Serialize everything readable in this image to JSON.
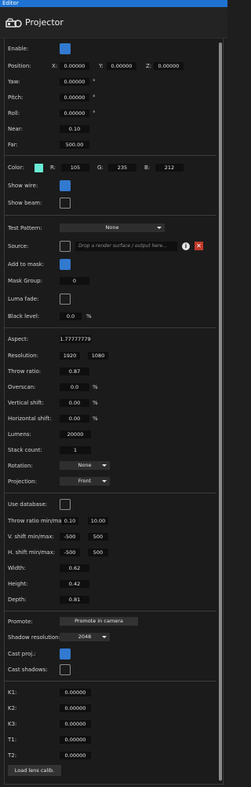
{
  "window": {
    "title": "Editor"
  },
  "header": {
    "title": "Projector"
  },
  "transform": {
    "enable_label": "Enable:",
    "position_label": "Position:",
    "axis_x": "X:",
    "axis_y": "Y:",
    "axis_z": "Z:",
    "pos_x": "0.00000",
    "pos_y": "0.00000",
    "pos_z": "0.00000",
    "yaw_label": "Yaw:",
    "yaw": "0.00000",
    "pitch_label": "Pitch:",
    "pitch": "0.00000",
    "roll_label": "Roll:",
    "roll": "0.00000",
    "degree_unit": "°",
    "near_label": "Near:",
    "near": "0.10",
    "far_label": "Far:",
    "far": "500.00"
  },
  "appearance": {
    "color_label": "Color:",
    "r_label": "R:",
    "r": "105",
    "g_label": "G:",
    "g": "235",
    "b_label": "B:",
    "b": "212",
    "show_wire_label": "Show wire:",
    "show_beam_label": "Show beam:",
    "swatch_color": "#69ebd4"
  },
  "pattern": {
    "test_pattern_label": "Test Pattern:",
    "test_pattern_value": "None",
    "source_label": "Source:",
    "source_placeholder": "Drop a render surface / output here...",
    "add_to_mask_label": "Add to mask:",
    "mask_group_label": "Mask Group:",
    "mask_group": "0",
    "luma_fade_label": "Luma fade:",
    "black_level_label": "Black level:",
    "black_level": "0.0",
    "percent": "%"
  },
  "lens": {
    "aspect_label": "Aspect:",
    "aspect": "1.77777779",
    "resolution_label": "Resolution:",
    "res_w": "1920",
    "res_h": "1080",
    "throw_ratio_label": "Throw ratio:",
    "throw_ratio": "0.87",
    "overscan_label": "Overscan:",
    "overscan": "0.0",
    "vshift_label": "Vertical  shift:",
    "vshift": "0.00",
    "hshift_label": "Horizontal  shift:",
    "hshift": "0.00",
    "lumens_label": "Lumens:",
    "lumens": "20000",
    "stack_label": "Stack count:",
    "stack": "1",
    "rotation_label": "Rotation:",
    "rotation": "None",
    "projection_label": "Projection:",
    "projection": "Front"
  },
  "database": {
    "use_db_label": "Use database:",
    "tr_minmax_label": "Throw ratio min/max:",
    "tr_min": "0.10",
    "tr_max": "10.00",
    "vs_minmax_label": "V. shift min/max:",
    "vs_min": "-500",
    "vs_max": "500",
    "hs_minmax_label": "H. shift min/max:",
    "hs_min": "-500",
    "hs_max": "500",
    "width_label": "Width:",
    "width": "0.62",
    "height_label": "Height:",
    "height": "0.42",
    "depth_label": "Depth:",
    "depth": "0.81"
  },
  "promote": {
    "promote_label": "Promote:",
    "promote_button": "Promote in camera",
    "shadow_res_label": "Shadow resolution:",
    "shadow_res": "2048",
    "cast_proj_label": "Cast proj.:",
    "cast_shadows_label": "Cast shadows:"
  },
  "calibration": {
    "k1_label": "K1:",
    "k1": "0.00000",
    "k2_label": "K2:",
    "k2": "0.00000",
    "k3_label": "K3:",
    "k3": "0.00000",
    "t1_label": "T1:",
    "t1": "0.00000",
    "t2_label": "T2:",
    "t2": "0.00000",
    "load_button": "Load lens calib."
  }
}
